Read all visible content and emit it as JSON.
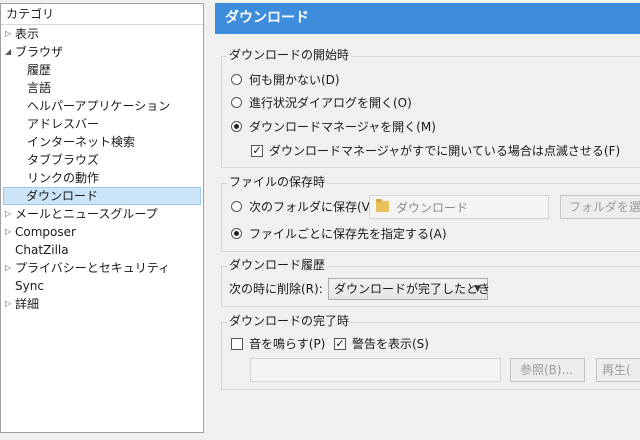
{
  "sidebar": {
    "header": "カテゴリ",
    "items": [
      {
        "label": "表示",
        "twisty": "▷"
      },
      {
        "label": "ブラウザ",
        "twisty": "◢"
      },
      {
        "label": "履歴"
      },
      {
        "label": "言語"
      },
      {
        "label": "ヘルパーアプリケーション"
      },
      {
        "label": "アドレスバー"
      },
      {
        "label": "インターネット検索"
      },
      {
        "label": "タブブラウズ"
      },
      {
        "label": "リンクの動作"
      },
      {
        "label": "ダウンロード",
        "selected": true
      },
      {
        "label": "メールとニュースグループ",
        "twisty": "▷"
      },
      {
        "label": "Composer",
        "twisty": "▷"
      },
      {
        "label": "ChatZilla"
      },
      {
        "label": "プライバシーとセキュリティ",
        "twisty": "▷"
      },
      {
        "label": "Sync"
      },
      {
        "label": "詳細",
        "twisty": "▷"
      }
    ]
  },
  "pane": {
    "title": "ダウンロード",
    "accent_color": "#3e8ddd"
  },
  "start": {
    "caption": "ダウンロードの開始時",
    "opt_nothing": "何も開かない(D)",
    "opt_progress": "進行状況ダイアログを開く(O)",
    "opt_manager": "ダウンロードマネージャを開く(M)",
    "flash_check": "ダウンロードマネージャがすでに開いている場合は点滅させる(F)",
    "selected": "manager",
    "flash_checked": true
  },
  "save": {
    "caption": "ファイルの保存時",
    "opt_folder": "次のフォルダに保存(V)",
    "folder_value": "ダウンロード",
    "folder_button": "フォルダを選択(",
    "opt_ask": "ファイルごとに保存先を指定する(A)",
    "selected": "ask"
  },
  "history": {
    "caption": "ダウンロード履歴",
    "label": "次の時に削除(R):",
    "selected_value": "ダウンロードが完了したとき"
  },
  "complete": {
    "caption": "ダウンロードの完了時",
    "play_sound": "音を鳴らす(P)",
    "play_sound_checked": false,
    "show_alert": "警告を表示(S)",
    "show_alert_checked": true,
    "browse_button": "参照(B)...",
    "replay_button": "再生("
  }
}
